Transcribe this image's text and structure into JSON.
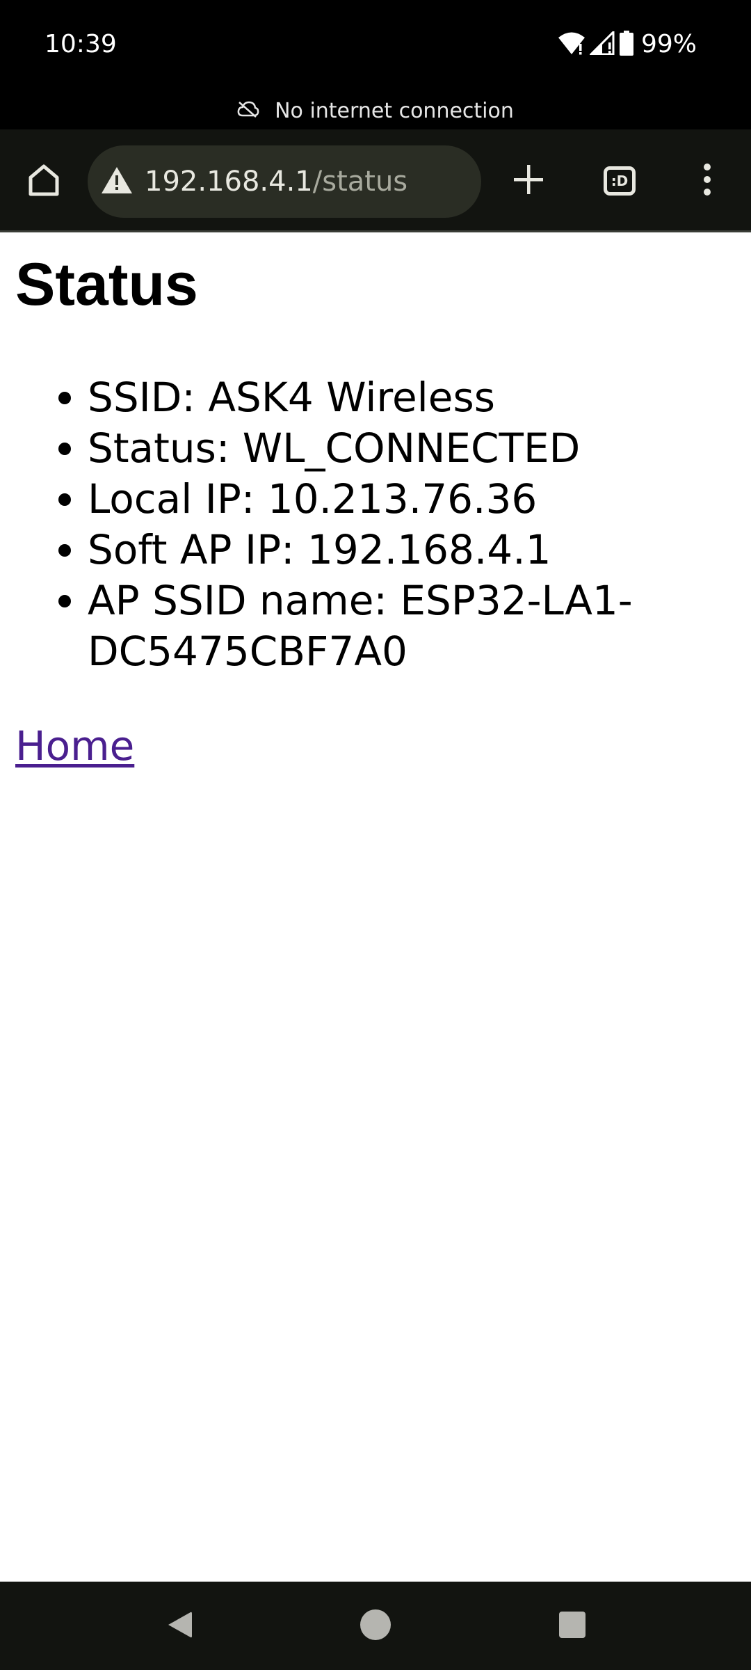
{
  "status_bar": {
    "time": "10:39",
    "battery": "99%",
    "icons": [
      "wifi-icon",
      "cell-signal-icon",
      "battery-icon"
    ]
  },
  "connection_banner": {
    "icon": "cloud-off-icon",
    "text": "No internet connection"
  },
  "toolbar": {
    "home_icon": "home-icon",
    "warning_icon": "warning-icon",
    "url_host": "192.168.4.1",
    "url_path": "/status",
    "new_tab_icon": "plus-icon",
    "tab_switcher_label": ":D",
    "menu_icon": "more-vert-icon"
  },
  "page": {
    "title": "Status",
    "items": [
      "SSID: ASK4 Wireless",
      "Status: WL_CONNECTED",
      "Local IP: 10.213.76.36",
      "Soft AP IP: 192.168.4.1",
      "AP SSID name: ESP32-LA1-DC5475CBF7A0"
    ],
    "home_link": "Home",
    "link_color": "#4a1f8f"
  },
  "nav_bar": {
    "back_icon": "back-triangle-icon",
    "home_icon": "home-circle-icon",
    "recents_icon": "recents-square-icon"
  }
}
